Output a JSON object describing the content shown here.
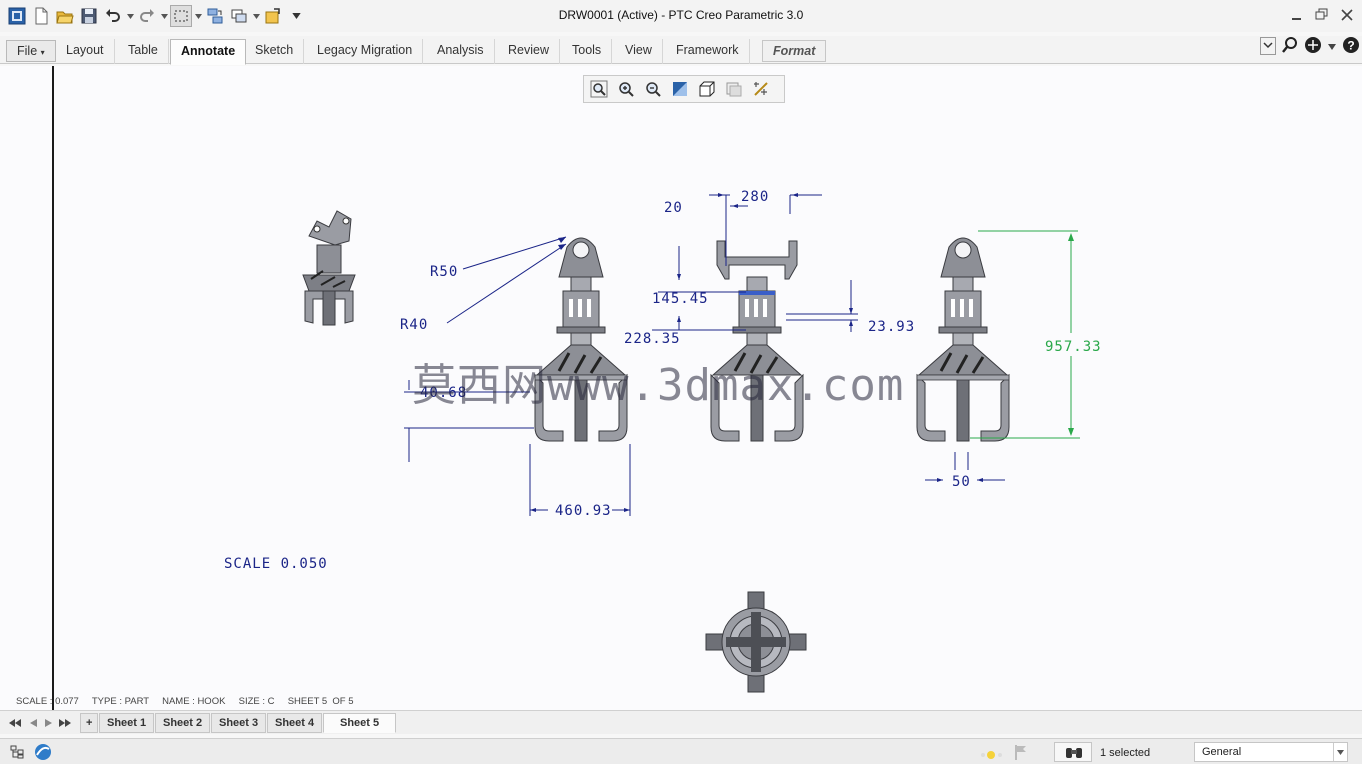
{
  "window": {
    "title": "DRW0001 (Active) - PTC Creo Parametric 3.0"
  },
  "ribbon": {
    "file_label": "File",
    "tabs": [
      "Layout",
      "Table",
      "Annotate",
      "Sketch",
      "Legacy Migration",
      "Analysis",
      "Review",
      "Tools",
      "View",
      "Framework"
    ],
    "active_tab": "Annotate",
    "format_label": "Format"
  },
  "drawing": {
    "dimensions": {
      "r50": "R50",
      "r40": "R40",
      "d20": "20",
      "d280": "280",
      "d145": "145.45",
      "d228": "228.35",
      "d23": "23.93",
      "d957": "957.33",
      "d460": "460.93",
      "d40": "40.68",
      "d50": "50"
    },
    "scale_note": "SCALE  0.050",
    "sheet_info": "SCALE : 0.077     TYPE : PART     NAME : HOOK     SIZE : C     SHEET 5  OF 5",
    "watermark": "莫西网www.3dmax.com"
  },
  "sheets": {
    "add_label": "+",
    "items": [
      "Sheet 1",
      "Sheet 2",
      "Sheet 3",
      "Sheet 4",
      "Sheet 5"
    ],
    "active": "Sheet 5"
  },
  "status": {
    "selected": "1 selected",
    "filter_value": "General"
  },
  "colors": {
    "dimension_blue": "#1b2588",
    "dimension_green": "#2aa84a",
    "part_gray": "#8d8f96"
  },
  "icons": {
    "quick_access": [
      "app-icon",
      "new-icon",
      "open-icon",
      "save-icon",
      "undo-icon",
      "redo-icon",
      "select-box-icon",
      "regenerate-icon",
      "window-switch-icon",
      "close-window-icon",
      "customize-icon"
    ],
    "view_toolbar": [
      "refit-icon",
      "zoom-in-icon",
      "zoom-out-icon",
      "repaint-icon",
      "display-style-icon",
      "saved-views-icon",
      "annotation-display-icon"
    ]
  }
}
